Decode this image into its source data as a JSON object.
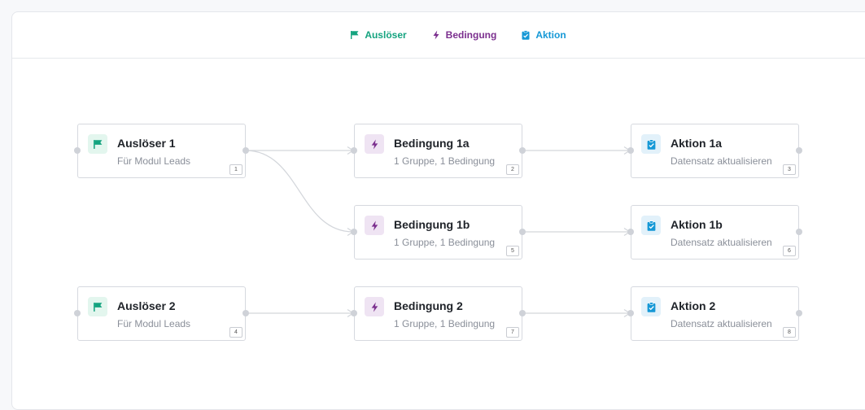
{
  "legend": {
    "trigger_label": "Auslöser",
    "condition_label": "Bedingung",
    "action_label": "Aktion"
  },
  "colors": {
    "trigger": "#14a37f",
    "condition": "#7b2f8e",
    "action": "#1598d6",
    "edge": "#d3d6db"
  },
  "nodes": [
    {
      "id": "1",
      "kind": "trigger",
      "title": "Auslöser 1",
      "subtitle": "Für Modul Leads",
      "number": "1"
    },
    {
      "id": "2",
      "kind": "condition",
      "title": "Bedingung 1a",
      "subtitle": "1 Gruppe, 1 Bedingung",
      "number": "2"
    },
    {
      "id": "3",
      "kind": "action",
      "title": "Aktion 1a",
      "subtitle": "Datensatz aktualisieren",
      "number": "3"
    },
    {
      "id": "5",
      "kind": "condition",
      "title": "Bedingung 1b",
      "subtitle": "1 Gruppe, 1 Bedingung",
      "number": "5"
    },
    {
      "id": "6",
      "kind": "action",
      "title": "Aktion 1b",
      "subtitle": "Datensatz aktualisieren",
      "number": "6"
    },
    {
      "id": "4",
      "kind": "trigger",
      "title": "Auslöser 2",
      "subtitle": "Für Modul Leads",
      "number": "4"
    },
    {
      "id": "7",
      "kind": "condition",
      "title": "Bedingung 2",
      "subtitle": "1 Gruppe, 1 Bedingung",
      "number": "7"
    },
    {
      "id": "8",
      "kind": "action",
      "title": "Aktion 2",
      "subtitle": "Datensatz aktualisieren",
      "number": "8"
    }
  ],
  "edges": [
    {
      "from": "1",
      "to": "2"
    },
    {
      "from": "1",
      "to": "5"
    },
    {
      "from": "2",
      "to": "3"
    },
    {
      "from": "5",
      "to": "6"
    },
    {
      "from": "4",
      "to": "7"
    },
    {
      "from": "7",
      "to": "8"
    }
  ]
}
